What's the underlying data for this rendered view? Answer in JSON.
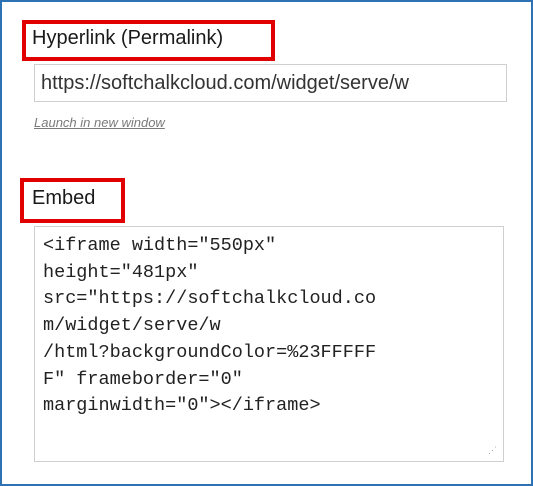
{
  "hyperlink": {
    "label": "Hyperlink (Permalink)",
    "url_value": "https://softchalkcloud.com/widget/serve/w",
    "launch_link": "Launch in new window"
  },
  "embed": {
    "label": "Embed",
    "code_lines": [
      "<iframe width=\"550px\"",
      "height=\"481px\"",
      "src=\"https://softchalkcloud.co",
      "m/widget/serve/w",
      "/html?backgroundColor=%23FFFFF",
      "F\" frameborder=\"0\"",
      "marginwidth=\"0\"></iframe>"
    ]
  },
  "colors": {
    "frame_border": "#2f72b4",
    "highlight_box": "#e00000"
  }
}
